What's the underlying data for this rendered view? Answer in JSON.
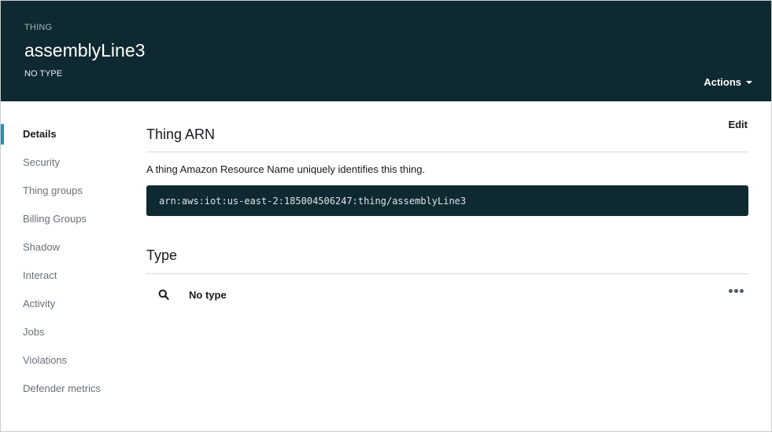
{
  "header": {
    "eyebrow": "THING",
    "title": "assemblyLine3",
    "subtitle": "NO TYPE",
    "actions_label": "Actions"
  },
  "sidebar": {
    "items": [
      {
        "label": "Details",
        "active": true
      },
      {
        "label": "Security"
      },
      {
        "label": "Thing groups"
      },
      {
        "label": "Billing Groups"
      },
      {
        "label": "Shadow"
      },
      {
        "label": "Interact"
      },
      {
        "label": "Activity"
      },
      {
        "label": "Jobs"
      },
      {
        "label": "Violations"
      },
      {
        "label": "Defender metrics"
      }
    ]
  },
  "main": {
    "arn_section": {
      "title": "Thing ARN",
      "edit_label": "Edit",
      "description": "A thing Amazon Resource Name uniquely identifies this thing.",
      "arn": "arn:aws:iot:us-east-2:185004506247:thing/assemblyLine3"
    },
    "type_section": {
      "title": "Type",
      "value": "No type",
      "search_icon": "search-icon",
      "more_icon": "ellipsis-icon"
    }
  },
  "colors": {
    "header_bg": "#0e2930",
    "active_accent": "#1b95b8",
    "arn_box_bg": "#0e2930"
  }
}
